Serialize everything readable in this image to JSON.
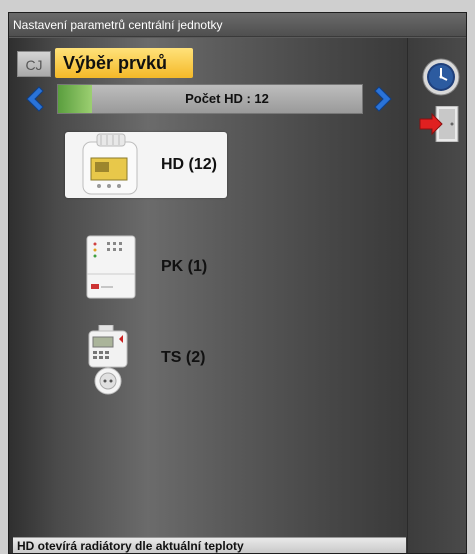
{
  "window": {
    "title": "Nastavení parametrů centrální jednotky"
  },
  "header": {
    "cj_label": "CJ",
    "section_title": "Výběr prvků"
  },
  "navigation": {
    "count_text": "Počet HD : 12",
    "prev_icon": "chevron-left-icon",
    "next_icon": "chevron-right-icon"
  },
  "devices": [
    {
      "label": "HD (12)",
      "icon": "thermostat-head-icon",
      "selected": true
    },
    {
      "label": "PK (1)",
      "icon": "control-panel-icon",
      "selected": false
    },
    {
      "label": "TS (2)",
      "icon": "smart-socket-icon",
      "selected": false
    }
  ],
  "status": {
    "text": "HD otevírá radiátory dle aktuální teploty"
  },
  "side": {
    "clock_icon": "clock-icon",
    "exit_icon": "exit-door-icon"
  },
  "colors": {
    "section_title_bg": "#f4b928",
    "arrow_blue": "#2a73d8",
    "progress_green": "#7ab85a",
    "exit_red": "#e02020"
  }
}
